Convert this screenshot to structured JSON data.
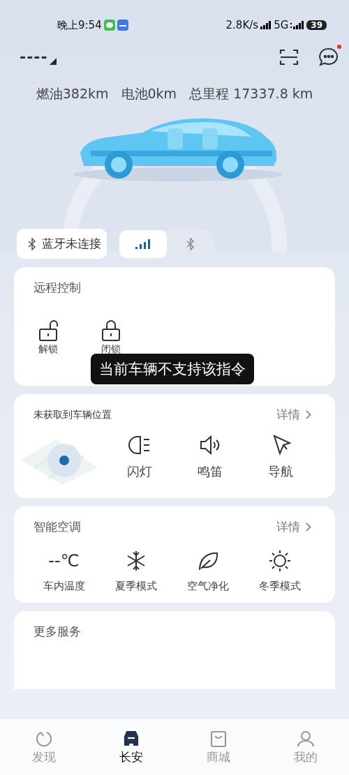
{
  "status_bar": {
    "time": "晚上9:54",
    "speed": "2.8K/s",
    "network": "5G",
    "battery": "39"
  },
  "header": {
    "title": "----"
  },
  "mileage": [
    "燃油382km",
    "电池0km",
    "总里程 17337.8 km"
  ],
  "car_picture": {
    "kind": "picture"
  },
  "bluetooth": {
    "label": "蓝牙未连接",
    "modes": [
      {
        "kind": "signal",
        "selected": true
      },
      {
        "kind": "bluetooth",
        "selected": false
      }
    ]
  },
  "remote_control": {
    "title": "远程控制",
    "actions": [
      {
        "kind": "unlock",
        "label": "解锁"
      },
      {
        "kind": "lock",
        "label": "闭锁"
      }
    ]
  },
  "toast": "当前车辆不支持该指令",
  "location": {
    "title": "未获取到车辆位置",
    "detail": "详情",
    "actions": [
      {
        "kind": "flash",
        "label": "闪灯"
      },
      {
        "kind": "horn",
        "label": "鸣笛"
      },
      {
        "kind": "navigate",
        "label": "导航"
      }
    ]
  },
  "climate": {
    "title": "智能空调",
    "detail": "详情",
    "items": [
      {
        "kind": "temperature",
        "value": "--℃",
        "label": "车内温度"
      },
      {
        "kind": "summer",
        "label": "夏季模式"
      },
      {
        "kind": "purify",
        "label": "空气净化"
      },
      {
        "kind": "winter",
        "label": "冬季模式"
      }
    ]
  },
  "more_services": {
    "title": "更多服务"
  },
  "tabs": [
    {
      "kind": "discover",
      "label": "发现",
      "selected": false
    },
    {
      "kind": "car",
      "label": "长安",
      "selected": true
    },
    {
      "kind": "shop",
      "label": "商城",
      "selected": false
    },
    {
      "kind": "profile",
      "label": "我的",
      "selected": false
    }
  ]
}
